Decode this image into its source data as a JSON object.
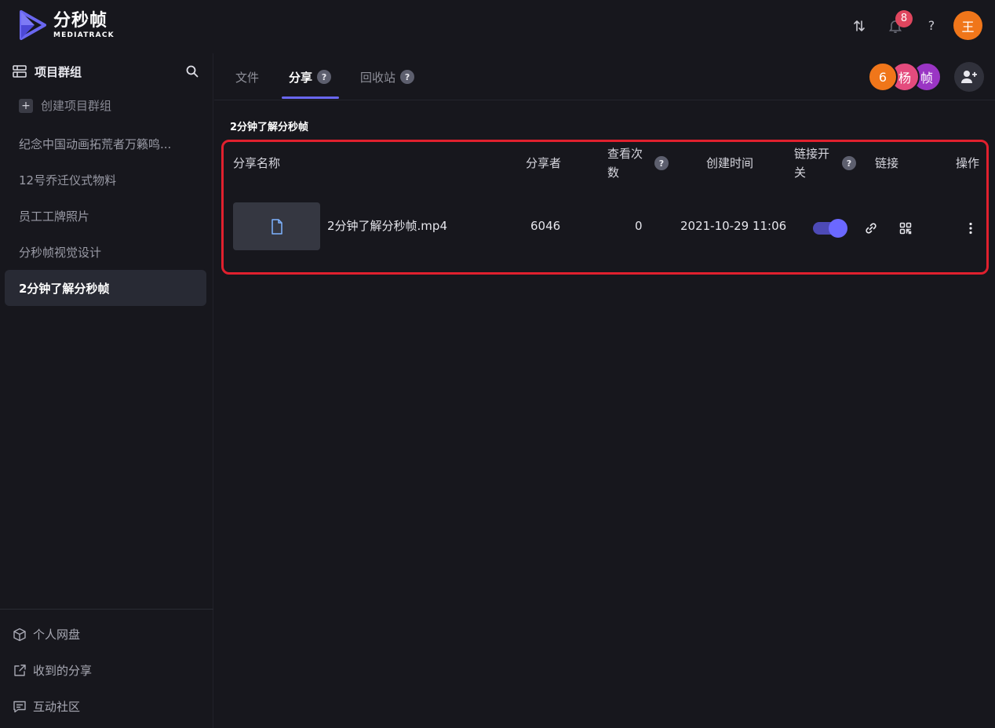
{
  "app": {
    "logo_cn": "分秒帧",
    "logo_en": "MEDIATRACK"
  },
  "topbar": {
    "notification_count": "8",
    "help_label": "?",
    "user_avatar": "王",
    "icons": [
      "transfer-icon",
      "bell-icon",
      "help-icon"
    ]
  },
  "sidebar": {
    "header_label": "项目群组",
    "create_label": "创建项目群组",
    "items": [
      {
        "label": "纪念中国动画拓荒者万籁鸣..."
      },
      {
        "label": "12号乔迁仪式物料"
      },
      {
        "label": "员工工牌照片"
      },
      {
        "label": "分秒帧视觉设计"
      },
      {
        "label": "2分钟了解分秒帧",
        "active": true
      }
    ],
    "footer": [
      {
        "label": "个人网盘",
        "icon": "cube-icon"
      },
      {
        "label": "收到的分享",
        "icon": "share-icon"
      },
      {
        "label": "互动社区",
        "icon": "message-icon"
      }
    ]
  },
  "tabs": {
    "items": [
      {
        "label": "文件"
      },
      {
        "label": "分享",
        "help": "?",
        "active": true
      },
      {
        "label": "回收站",
        "help": "?"
      }
    ]
  },
  "members": {
    "count": "6",
    "avatars": [
      {
        "text": "杨",
        "color": "#e44b7d"
      },
      {
        "text": "帧",
        "color": "#9a35c4"
      }
    ],
    "count_color": "#f0761a"
  },
  "main": {
    "group_title": "2分钟了解分秒帧",
    "table": {
      "headers": {
        "name": "分享名称",
        "sharer": "分享者",
        "views_line1": "查看次",
        "views_line2": "数",
        "created": "创建时间",
        "toggle_line1": "链接开",
        "toggle_line2": "关",
        "link": "链接",
        "actions": "操作",
        "help": "?"
      },
      "rows": [
        {
          "name": "2分钟了解分秒帧.mp4",
          "sharer": "6046",
          "views": "0",
          "created": "2021-10-29 11:06",
          "link_enabled": true
        }
      ]
    }
  },
  "colors": {
    "accent": "#6a67f0",
    "highlight_frame": "#e0202e",
    "background": "#17171d"
  }
}
